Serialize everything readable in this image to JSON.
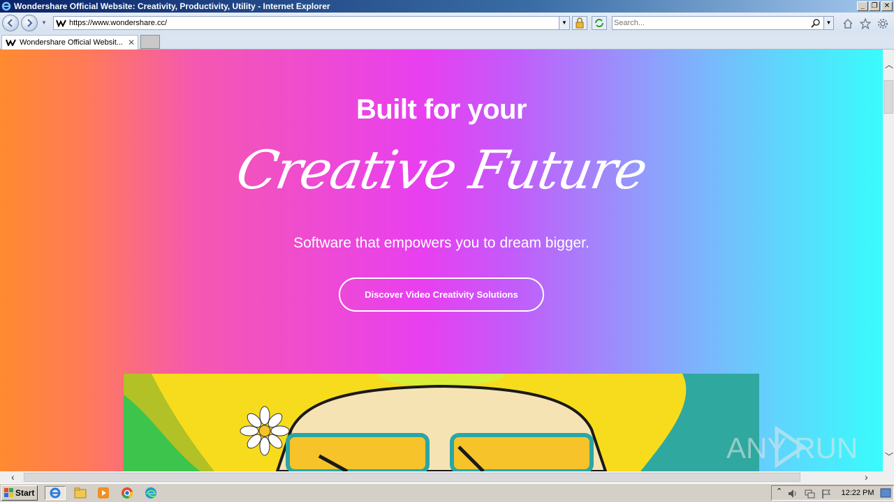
{
  "window": {
    "title": "Wondershare Official Website: Creativity, Productivity, Utility - Internet Explorer",
    "controls": {
      "minimize": "_",
      "restore": "❐",
      "close": "✕"
    }
  },
  "toolbar": {
    "url": "https://www.wondershare.cc/",
    "search_placeholder": "Search..."
  },
  "tabs": [
    {
      "label": "Wondershare Official Websit...",
      "close": "✕"
    }
  ],
  "hero": {
    "title": "Built for your",
    "script": "Creative Future",
    "subtitle": "Software that empowers you to dream bigger.",
    "cta": "Discover Video Creativity Solutions"
  },
  "watermark": {
    "text": "ANY RUN"
  },
  "taskbar": {
    "start_label": "Start",
    "clock": "12:22 PM",
    "pinned": [
      "internet-explorer-icon",
      "explorer-folder-icon",
      "media-player-icon",
      "chrome-icon",
      "edge-icon"
    ]
  },
  "colors": {
    "gradient_left": "#ff8a30",
    "gradient_mid": "#e83ff0",
    "gradient_right": "#38fcfc",
    "illustration_yellow": "#f7dc1d"
  }
}
